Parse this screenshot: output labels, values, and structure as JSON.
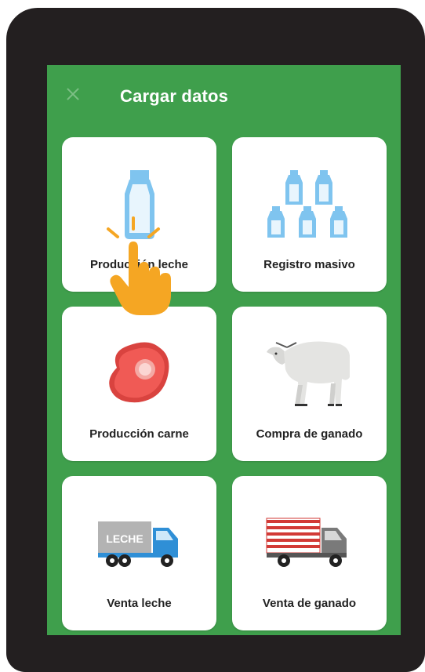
{
  "header": {
    "title": "Cargar datos",
    "close_icon": "close-icon"
  },
  "cards": [
    {
      "label": "Producción leche",
      "icon": "milk-bottle-icon"
    },
    {
      "label": "Registro masivo",
      "icon": "milk-bottles-icon"
    },
    {
      "label": "Producción carne",
      "icon": "meat-steak-icon"
    },
    {
      "label": "Compra de ganado",
      "icon": "cow-icon"
    },
    {
      "label": "Venta leche",
      "icon": "milk-truck-icon",
      "truck_text": "LECHE"
    },
    {
      "label": "Venta de ganado",
      "icon": "cattle-truck-icon"
    }
  ],
  "colors": {
    "background": "#3f9f4c",
    "card": "#ffffff",
    "hand": "#f5a623"
  }
}
